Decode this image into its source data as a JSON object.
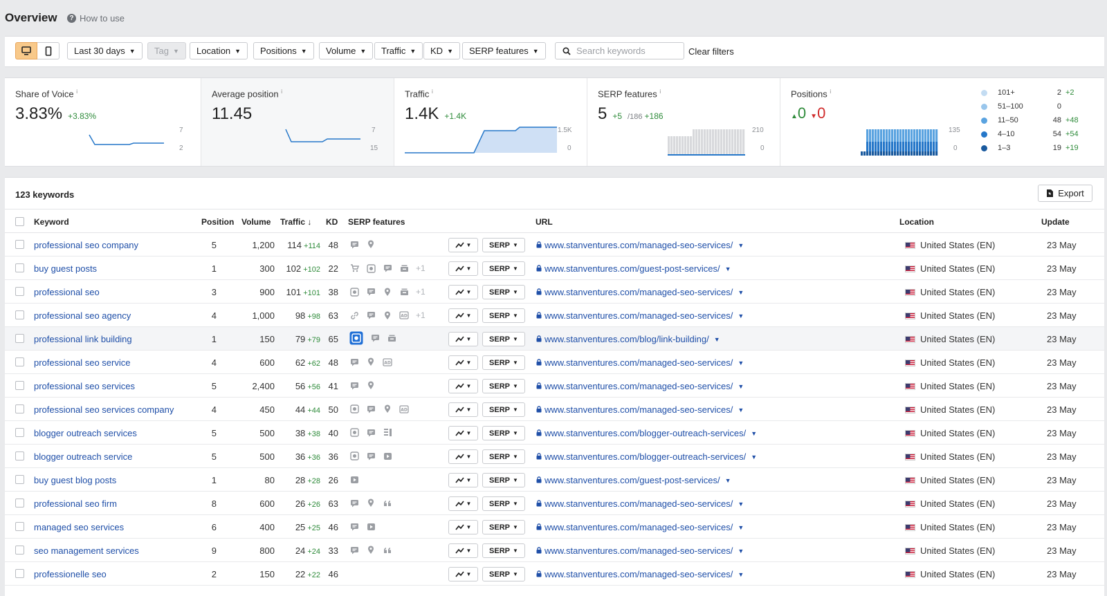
{
  "header": {
    "title": "Overview",
    "how_to_use": "How to use"
  },
  "filters": {
    "date": "Last 30 days",
    "tag": "Tag",
    "location": "Location",
    "positions": "Positions",
    "volume": "Volume",
    "traffic": "Traffic",
    "kd": "KD",
    "serp_features": "SERP features",
    "search_placeholder": "Search keywords",
    "clear": "Clear filters"
  },
  "metrics": {
    "share_of_voice": {
      "label": "Share of Voice",
      "value": "3.83%",
      "delta": "+3.83%",
      "axis_top": "7",
      "axis_bottom": "2"
    },
    "avg_position": {
      "label": "Average position",
      "value": "11.45",
      "axis_top": "7",
      "axis_bottom": "15"
    },
    "traffic": {
      "label": "Traffic",
      "value": "1.4K",
      "delta": "+1.4K",
      "axis_top": "1.5K",
      "axis_bottom": "0"
    },
    "serp_features": {
      "label": "SERP features",
      "value": "5",
      "delta": "+5",
      "sub": "/186",
      "sub_delta": "+186",
      "axis_top": "210",
      "axis_bottom": "0"
    },
    "positions": {
      "label": "Positions",
      "up": "0",
      "down": "0",
      "axis_top": "135",
      "axis_bottom": "0"
    }
  },
  "positions_legend": [
    {
      "label": "101+",
      "count": "2",
      "delta": "+2",
      "color": "#c3dcf2"
    },
    {
      "label": "51–100",
      "count": "0",
      "delta": "",
      "color": "#99c6ec"
    },
    {
      "label": "11–50",
      "count": "48",
      "delta": "+48",
      "color": "#5aa3e0"
    },
    {
      "label": "4–10",
      "count": "54",
      "delta": "+54",
      "color": "#2577c9"
    },
    {
      "label": "1–3",
      "count": "19",
      "delta": "+19",
      "color": "#1a5a9e"
    }
  ],
  "table": {
    "count_label": "123 keywords",
    "export_label": "Export",
    "headers": {
      "keyword": "Keyword",
      "position": "Position",
      "volume": "Volume",
      "traffic": "Traffic ↓",
      "kd": "KD",
      "serp_features": "SERP features",
      "url": "URL",
      "location": "Location",
      "update": "Update"
    },
    "serp_btn": "SERP",
    "rows": [
      {
        "keyword": "professional seo company",
        "position": "5",
        "volume": "1,200",
        "traffic": "114",
        "traffic_delta": "+114",
        "kd": "48",
        "features": [
          "review-icon",
          "pin-icon"
        ],
        "more": "",
        "url": "www.stanventures.com/managed-seo-services/",
        "location": "United States (EN)",
        "update": "23 May"
      },
      {
        "keyword": "buy guest posts",
        "position": "1",
        "volume": "300",
        "traffic": "102",
        "traffic_delta": "+102",
        "kd": "22",
        "features": [
          "cart-icon",
          "image-pack-icon",
          "review-icon",
          "stack-icon"
        ],
        "more": "+1",
        "url": "www.stanventures.com/guest-post-services/",
        "location": "United States (EN)",
        "update": "23 May"
      },
      {
        "keyword": "professional seo",
        "position": "3",
        "volume": "900",
        "traffic": "101",
        "traffic_delta": "+101",
        "kd": "38",
        "features": [
          "image-pack-icon",
          "review-icon",
          "pin-icon",
          "stack-icon"
        ],
        "more": "+1",
        "url": "www.stanventures.com/managed-seo-services/",
        "location": "United States (EN)",
        "update": "23 May"
      },
      {
        "keyword": "professional seo agency",
        "position": "4",
        "volume": "1,000",
        "traffic": "98",
        "traffic_delta": "+98",
        "kd": "63",
        "features": [
          "link-icon",
          "review-icon",
          "pin-icon",
          "ad-icon"
        ],
        "more": "+1",
        "url": "www.stanventures.com/managed-seo-services/",
        "location": "United States (EN)",
        "update": "23 May"
      },
      {
        "keyword": "professional link building",
        "position": "1",
        "volume": "150",
        "traffic": "79",
        "traffic_delta": "+79",
        "kd": "65",
        "features": [
          "image-pack-active-icon",
          "review-icon",
          "stack-icon"
        ],
        "more": "",
        "url": "www.stanventures.com/blog/link-building/",
        "location": "United States (EN)",
        "update": "23 May"
      },
      {
        "keyword": "professional seo service",
        "position": "4",
        "volume": "600",
        "traffic": "62",
        "traffic_delta": "+62",
        "kd": "48",
        "features": [
          "review-icon",
          "pin-icon",
          "ad-icon"
        ],
        "more": "",
        "url": "www.stanventures.com/managed-seo-services/",
        "location": "United States (EN)",
        "update": "23 May"
      },
      {
        "keyword": "professional seo services",
        "position": "5",
        "volume": "2,400",
        "traffic": "56",
        "traffic_delta": "+56",
        "kd": "41",
        "features": [
          "review-icon",
          "pin-icon"
        ],
        "more": "",
        "url": "www.stanventures.com/managed-seo-services/",
        "location": "United States (EN)",
        "update": "23 May"
      },
      {
        "keyword": "professional seo services company",
        "position": "4",
        "volume": "450",
        "traffic": "44",
        "traffic_delta": "+44",
        "kd": "50",
        "features": [
          "image-pack-icon",
          "review-icon",
          "pin-icon",
          "ad-icon"
        ],
        "more": "",
        "url": "www.stanventures.com/managed-seo-services/",
        "location": "United States (EN)",
        "update": "23 May"
      },
      {
        "keyword": "blogger outreach services",
        "position": "5",
        "volume": "500",
        "traffic": "38",
        "traffic_delta": "+38",
        "kd": "40",
        "features": [
          "image-pack-icon",
          "review-icon",
          "list-icon"
        ],
        "more": "",
        "url": "www.stanventures.com/blogger-outreach-services/",
        "location": "United States (EN)",
        "update": "23 May"
      },
      {
        "keyword": "blogger outreach service",
        "position": "5",
        "volume": "500",
        "traffic": "36",
        "traffic_delta": "+36",
        "kd": "36",
        "features": [
          "image-pack-icon",
          "review-icon",
          "video-icon"
        ],
        "more": "",
        "url": "www.stanventures.com/blogger-outreach-services/",
        "location": "United States (EN)",
        "update": "23 May"
      },
      {
        "keyword": "buy guest blog posts",
        "position": "1",
        "volume": "80",
        "traffic": "28",
        "traffic_delta": "+28",
        "kd": "26",
        "features": [
          "video-icon"
        ],
        "more": "",
        "url": "www.stanventures.com/guest-post-services/",
        "location": "United States (EN)",
        "update": "23 May"
      },
      {
        "keyword": "professional seo firm",
        "position": "8",
        "volume": "600",
        "traffic": "26",
        "traffic_delta": "+26",
        "kd": "63",
        "features": [
          "review-icon",
          "pin-icon",
          "quote-icon"
        ],
        "more": "",
        "url": "www.stanventures.com/managed-seo-services/",
        "location": "United States (EN)",
        "update": "23 May"
      },
      {
        "keyword": "managed seo services",
        "position": "6",
        "volume": "400",
        "traffic": "25",
        "traffic_delta": "+25",
        "kd": "46",
        "features": [
          "review-icon",
          "video-icon"
        ],
        "more": "",
        "url": "www.stanventures.com/managed-seo-services/",
        "location": "United States (EN)",
        "update": "23 May"
      },
      {
        "keyword": "seo management services",
        "position": "9",
        "volume": "800",
        "traffic": "24",
        "traffic_delta": "+24",
        "kd": "33",
        "features": [
          "review-icon",
          "pin-icon",
          "quote-icon"
        ],
        "more": "",
        "url": "www.stanventures.com/managed-seo-services/",
        "location": "United States (EN)",
        "update": "23 May"
      },
      {
        "keyword": "professionelle seo",
        "position": "2",
        "volume": "150",
        "traffic": "22",
        "traffic_delta": "+22",
        "kd": "46",
        "features": [],
        "more": "",
        "url": "www.stanventures.com/managed-seo-services/",
        "location": "United States (EN)",
        "update": "23 May"
      }
    ]
  }
}
